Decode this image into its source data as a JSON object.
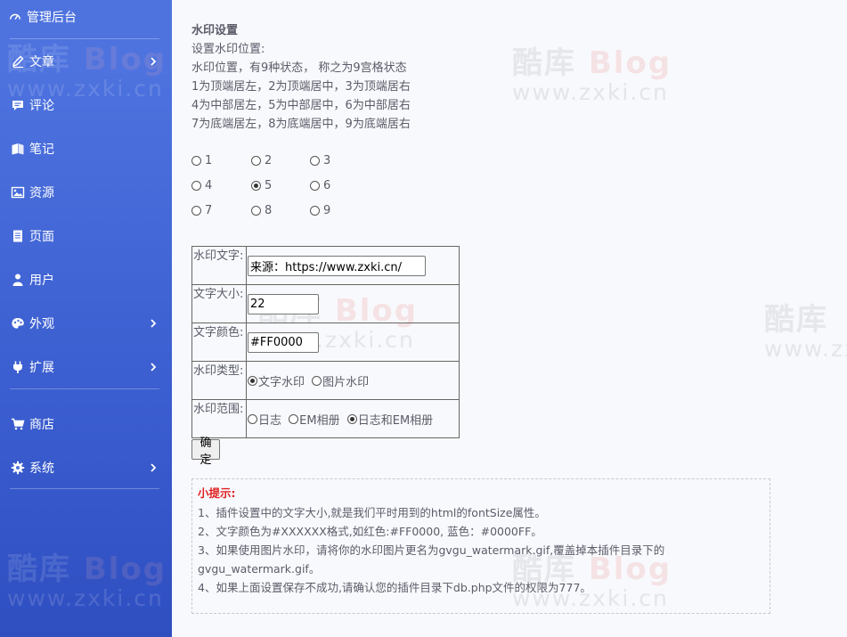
{
  "sidebar": {
    "brand": "管理后台",
    "items": [
      {
        "label": "文章",
        "icon": "pencil-icon",
        "has_submenu": true
      },
      {
        "label": "评论",
        "icon": "comment-icon",
        "has_submenu": false
      },
      {
        "label": "笔记",
        "icon": "sticky-note-icon",
        "has_submenu": false
      },
      {
        "label": "资源",
        "icon": "image-icon",
        "has_submenu": false
      },
      {
        "label": "页面",
        "icon": "file-icon",
        "has_submenu": false
      },
      {
        "label": "用户",
        "icon": "user-icon",
        "has_submenu": false
      },
      {
        "label": "外观",
        "icon": "palette-icon",
        "has_submenu": true
      },
      {
        "label": "扩展",
        "icon": "plug-icon",
        "has_submenu": true
      },
      {
        "label": "商店",
        "icon": "cart-icon",
        "has_submenu": false
      },
      {
        "label": "系统",
        "icon": "gear-icon",
        "has_submenu": true
      }
    ]
  },
  "content": {
    "title": "水印设置",
    "desc": [
      "设置水印位置:",
      "水印位置，有9种状态，  称之为9宫格状态",
      "1为顶端居左，2为顶端居中，3为顶端居右",
      "4为中部居左，5为中部居中，6为中部居右",
      "7为底端居左，8为底端居中，9为底端居右"
    ],
    "positions": [
      "1",
      "2",
      "3",
      "4",
      "5",
      "6",
      "7",
      "8",
      "9"
    ],
    "selected_position": "5",
    "form": {
      "text_label": "水印文字:",
      "text_value": "来源：https://www.zxki.cn/",
      "size_label": "文字大小:",
      "size_value": "22",
      "color_label": "文字颜色:",
      "color_value": "#FF0000",
      "type_label": "水印类型:",
      "type_options": [
        "文字水印",
        "图片水印"
      ],
      "type_selected": "文字水印",
      "scope_label": "水印范围:",
      "scope_options": [
        "日志",
        "EM相册",
        "日志和EM相册"
      ],
      "scope_selected": "日志和EM相册"
    },
    "submit_label": "确定",
    "tips": {
      "heading": "小提示:",
      "lines": [
        "1、插件设置中的文字大小,就是我们平时用到的html的fontSize属性。",
        "2、文字颜色为#XXXXXX格式,如红色:#FF0000, 蓝色：#0000FF。",
        "3、如果使用图片水印，请将你的水印图片更名为gvgu_watermark.gif,覆盖掉本插件目录下的",
        "gvgu_watermark.gif。",
        "4、如果上面设置保存不成功,请确认您的插件目录下db.php文件的权限为777。"
      ]
    }
  },
  "watermark": {
    "brand_cn": "酷库",
    "brand_blog": "Blog",
    "url": "www.zxki.cn"
  },
  "colors": {
    "sidebar_top": "#4e73df",
    "sidebar_bottom": "#2f4fc1",
    "page_bg": "#f8f9fc",
    "text": "#5a5c69",
    "tip_heading": "#e02020"
  }
}
